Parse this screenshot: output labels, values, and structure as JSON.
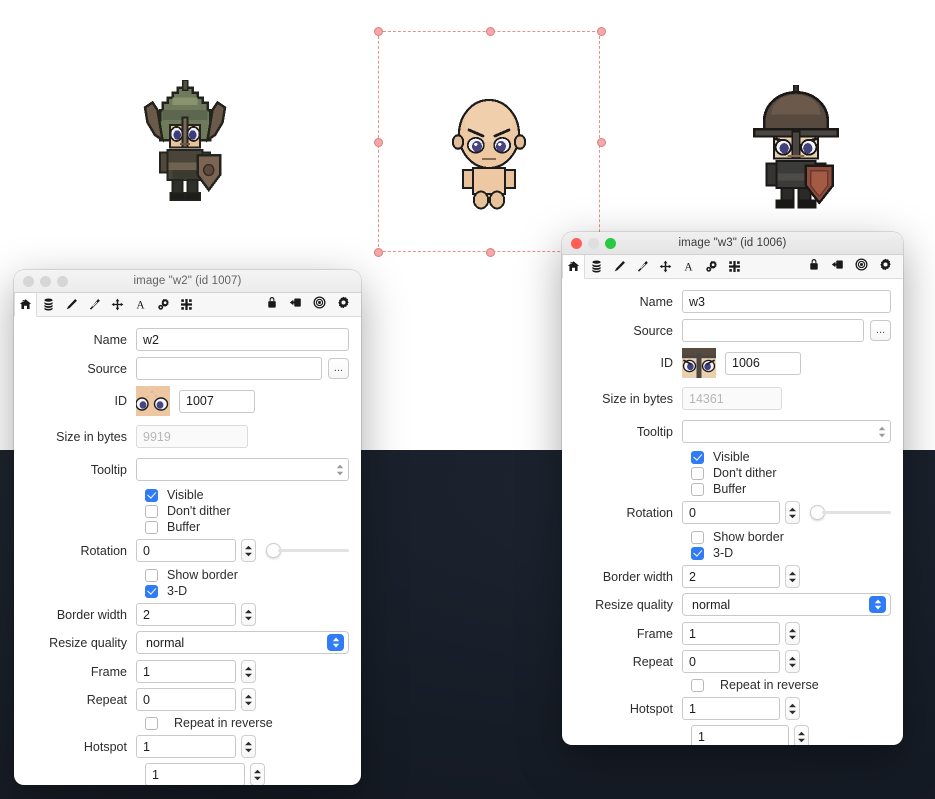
{
  "canvas": {
    "sprites": [
      {
        "name": "warrior-green-helm-sprite",
        "alt": "pixel-art chibi warrior with green helmet and shield"
      },
      {
        "name": "bald-chibi-sprite",
        "alt": "pixel-art bald chibi character, selected"
      },
      {
        "name": "warrior-dark-helm-sprite",
        "alt": "pixel-art chibi warrior with dark helmet and red shield"
      }
    ],
    "selection": {
      "name": "selection-marquee",
      "handles": [
        "nw",
        "n",
        "ne",
        "w",
        "e",
        "sw",
        "s",
        "se"
      ],
      "handle_color": "#f3a9a9",
      "border_color": "#e98f8f"
    }
  },
  "toolbar": {
    "left_icons": [
      {
        "name": "home-icon",
        "label": "Home",
        "selected": true
      },
      {
        "name": "stack-icon",
        "label": "Data"
      },
      {
        "name": "pencil-icon",
        "label": "Paint"
      },
      {
        "name": "magic-wand-icon",
        "label": "Effects"
      },
      {
        "name": "move-icon",
        "label": "Position"
      },
      {
        "name": "text-a-icon",
        "label": "Text"
      },
      {
        "name": "gears-icon",
        "label": "Behavior"
      },
      {
        "name": "resize-arrows-icon",
        "label": "Size"
      }
    ],
    "right_icons": [
      {
        "name": "lock-icon",
        "label": "Lock"
      },
      {
        "name": "export-icon",
        "label": "Export"
      },
      {
        "name": "target-icon",
        "label": "Target"
      },
      {
        "name": "gear-icon",
        "label": "Settings"
      }
    ]
  },
  "accent_color": "#2f7cf6",
  "windows": [
    {
      "id": "w2",
      "active": false,
      "title": "image \"w2\" (id 1007)",
      "traffic_lights": [
        "close",
        "minimize",
        "zoom"
      ],
      "fields": {
        "name_label": "Name",
        "name_value": "w2",
        "source_label": "Source",
        "source_value": "",
        "source_placeholder": "",
        "browse_label": "...",
        "id_label": "ID",
        "id_value": "1007",
        "size_label": "Size in bytes",
        "size_value": "9919",
        "tooltip_label": "Tooltip",
        "tooltip_value": "",
        "visible_label": "Visible",
        "visible_checked": true,
        "dither_label": "Don't dither",
        "dither_checked": false,
        "buffer_label": "Buffer",
        "buffer_checked": false,
        "rotation_label": "Rotation",
        "rotation_value": "0",
        "show_border_label": "Show border",
        "show_border_checked": false,
        "threed_label": "3-D",
        "threed_checked": true,
        "border_width_label": "Border width",
        "border_width_value": "2",
        "resize_quality_label": "Resize quality",
        "resize_quality_value": "normal",
        "frame_label": "Frame",
        "frame_value": "1",
        "repeat_label": "Repeat",
        "repeat_value": "0",
        "repeat_reverse_label": "Repeat in reverse",
        "repeat_reverse_checked": false,
        "hotspot_label": "Hotspot",
        "hotspot_x_value": "1",
        "hotspot_y_value": "1"
      }
    },
    {
      "id": "w3",
      "active": true,
      "title": "image \"w3\" (id 1006)",
      "traffic_lights": [
        "close",
        "minimize",
        "zoom"
      ],
      "fields": {
        "name_label": "Name",
        "name_value": "w3",
        "source_label": "Source",
        "source_value": "",
        "source_placeholder": "",
        "browse_label": "...",
        "id_label": "ID",
        "id_value": "1006",
        "size_label": "Size in bytes",
        "size_value": "14361",
        "tooltip_label": "Tooltip",
        "tooltip_value": "",
        "visible_label": "Visible",
        "visible_checked": true,
        "dither_label": "Don't dither",
        "dither_checked": false,
        "buffer_label": "Buffer",
        "buffer_checked": false,
        "rotation_label": "Rotation",
        "rotation_value": "0",
        "show_border_label": "Show border",
        "show_border_checked": false,
        "threed_label": "3-D",
        "threed_checked": true,
        "border_width_label": "Border width",
        "border_width_value": "2",
        "resize_quality_label": "Resize quality",
        "resize_quality_value": "normal",
        "frame_label": "Frame",
        "frame_value": "1",
        "repeat_label": "Repeat",
        "repeat_value": "0",
        "repeat_reverse_label": "Repeat in reverse",
        "repeat_reverse_checked": false,
        "hotspot_label": "Hotspot",
        "hotspot_x_value": "1",
        "hotspot_y_value": "1"
      }
    }
  ]
}
